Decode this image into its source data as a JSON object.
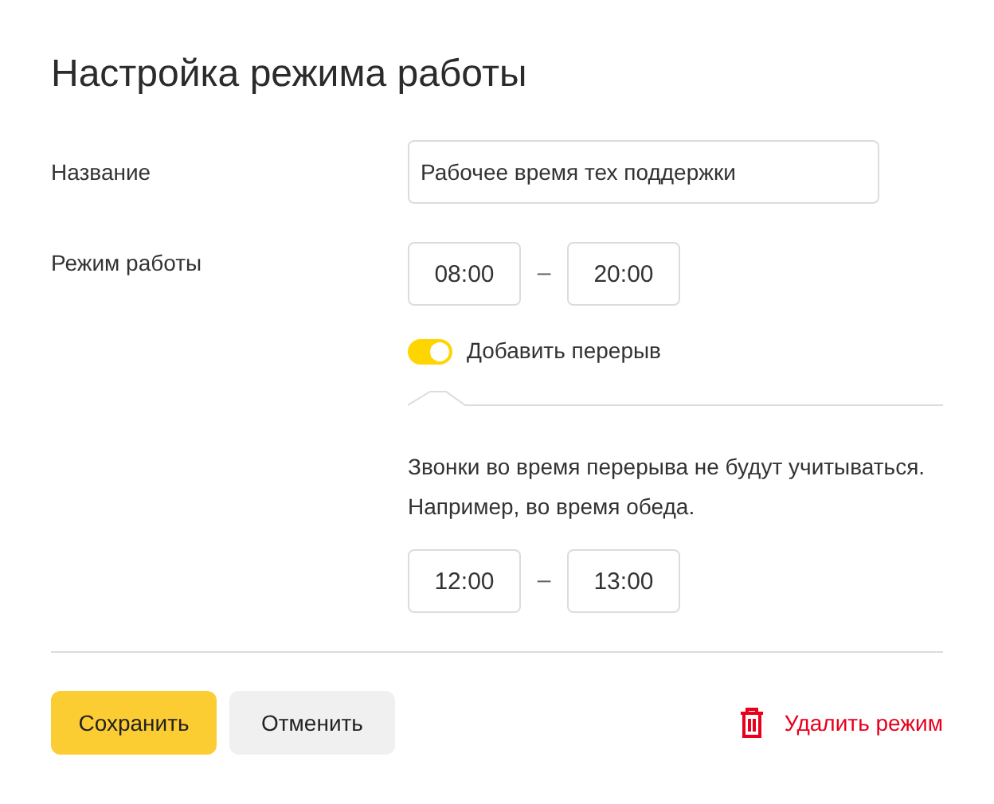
{
  "title": "Настройка режима работы",
  "name_field": {
    "label": "Название",
    "value": "Рабочее время тех поддержки"
  },
  "schedule": {
    "label": "Режим работы",
    "from": "08:00",
    "separator": "–",
    "to": "20:00"
  },
  "break_toggle": {
    "label": "Добавить перерыв",
    "on": true
  },
  "break": {
    "note": "Звонки во время перерыва не будут учитываться.",
    "example": "Например, во время обеда.",
    "from": "12:00",
    "separator": "–",
    "to": "13:00"
  },
  "buttons": {
    "save": "Сохранить",
    "cancel": "Отменить",
    "delete": "Удалить режим"
  }
}
